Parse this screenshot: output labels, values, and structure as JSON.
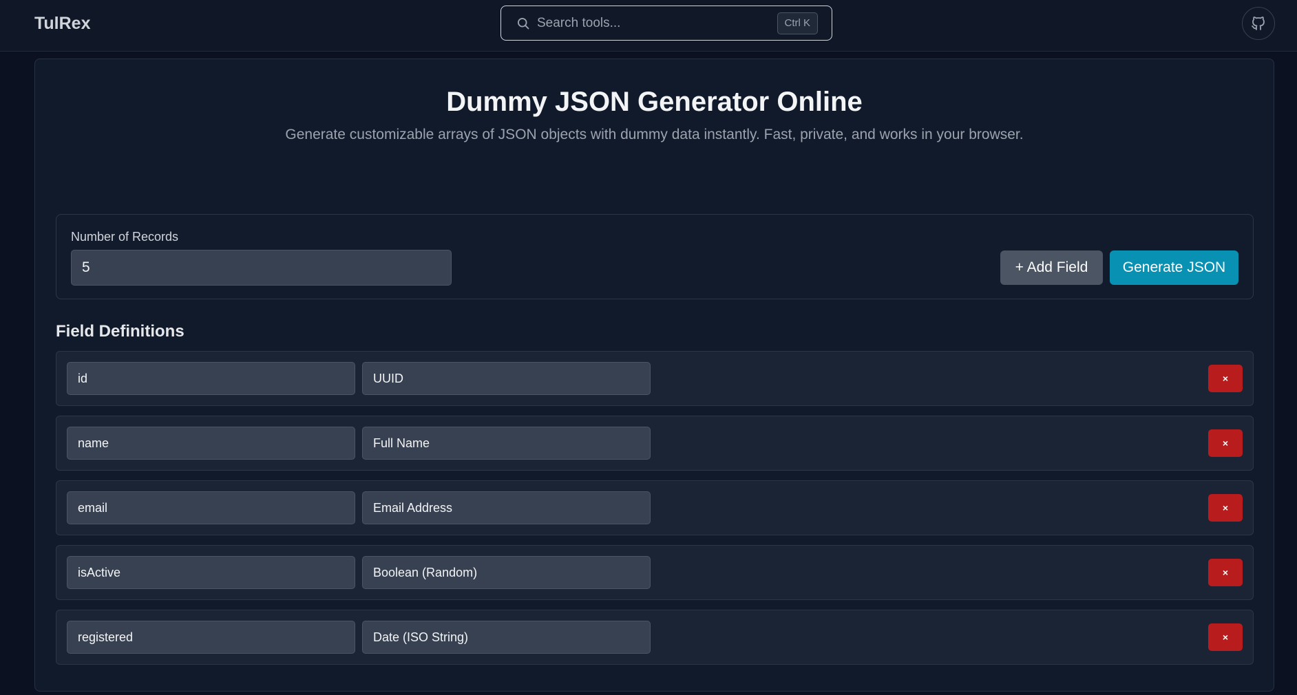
{
  "header": {
    "brand": "TulRex",
    "search": {
      "placeholder": "Search tools...",
      "shortcut": "Ctrl K"
    }
  },
  "main": {
    "title": "Dummy JSON Generator Online",
    "subtitle": "Generate customizable arrays of JSON objects with dummy data instantly. Fast, private, and works in your browser.",
    "records": {
      "label": "Number of Records",
      "value": "5"
    },
    "add_field_label": "+ Add Field",
    "generate_label": "Generate JSON",
    "fields_title": "Field Definitions",
    "fields": [
      {
        "name": "id",
        "type": "UUID",
        "remove_label": "×"
      },
      {
        "name": "name",
        "type": "Full Name",
        "remove_label": "×"
      },
      {
        "name": "email",
        "type": "Email Address",
        "remove_label": "×"
      },
      {
        "name": "isActive",
        "type": "Boolean (Random)",
        "remove_label": "×"
      },
      {
        "name": "registered",
        "type": "Date (ISO String)",
        "remove_label": "×"
      }
    ]
  },
  "icons": {
    "search": "search-icon",
    "github": "github-icon"
  },
  "colors": {
    "accent": "#0891b2",
    "danger": "#b91c1c",
    "background": "#0b1120"
  }
}
